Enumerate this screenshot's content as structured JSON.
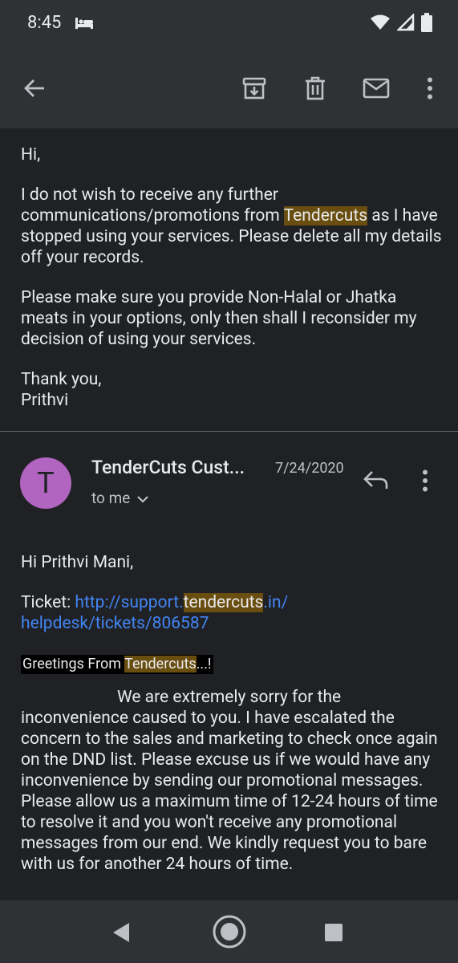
{
  "status_bar": {
    "time": "8:45"
  },
  "toolbar": {
    "back": "back-arrow-icon",
    "actions": [
      "archive-icon",
      "delete-icon",
      "mark-unread-icon",
      "more-vert-icon"
    ]
  },
  "message1": {
    "greeting": "Hi,",
    "p1_before": "I do not wish to receive any further communications/promotions from ",
    "p1_highlight": "Tendercuts",
    "p1_after": " as I have stopped using your services. Please delete all my details off your records.",
    "p2": "Please make sure you provide Non-Halal or Jhatka meats in your options, only then shall I reconsider my decision of using your services.",
    "closing": "Thank you,",
    "signature": "Prithvi"
  },
  "message2": {
    "avatar_letter": "T",
    "sender": "TenderCuts Cust...",
    "date": "7/24/2020",
    "to": "to me",
    "greeting": "Hi Prithvi Mani,",
    "ticket_label": "Ticket: ",
    "ticket_link_pre": "http://support.",
    "ticket_link_highlight": "tendercuts",
    "ticket_link_post": ".in/ helpdesk/tickets/806587",
    "greet_pre": "Greetings From ",
    "greet_highlight": "Tendercuts",
    "greet_post": "...!",
    "body": "We are extremely sorry for the inconvenience caused to you. I have escalated the concern to the sales and marketing to check once again on the DND list. Please excuse us if we would have any inconvenience by sending our promotional messages. Please allow us a maximum time of 12-24 hours of time to resolve it and you won't receive any promotional messages from our end. We kindly request you to bare with us for another 24 hours of time."
  },
  "colors": {
    "highlight": "#6a4e0f",
    "link": "#4285f4",
    "avatar": "#b165c1"
  }
}
